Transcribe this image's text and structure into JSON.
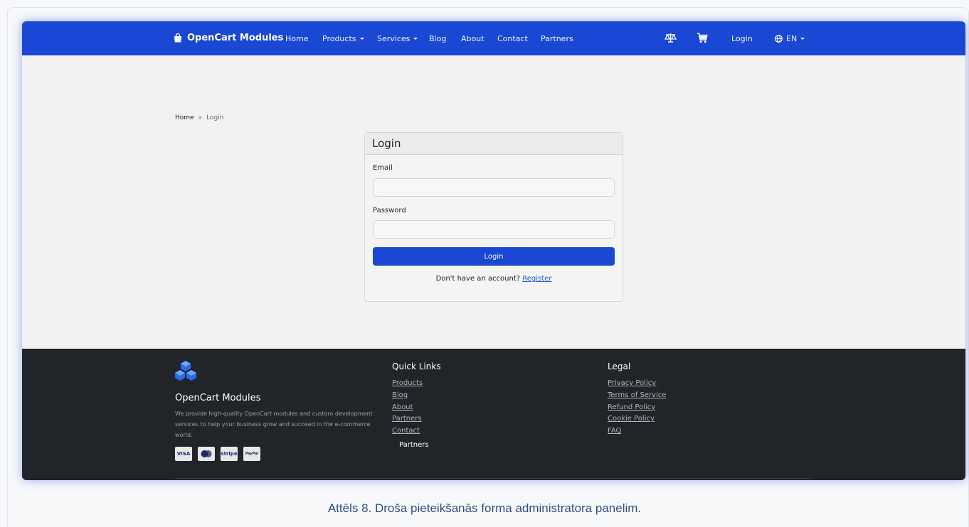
{
  "navbar": {
    "brand": "OpenCart Modules",
    "items": [
      {
        "label": "Home"
      },
      {
        "label": "Products"
      },
      {
        "label": "Services"
      },
      {
        "label": "Blog"
      },
      {
        "label": "About"
      },
      {
        "label": "Contact"
      },
      {
        "label": "Partners"
      }
    ],
    "icons": [
      "compare-icon",
      "cart-icon"
    ],
    "login": "Login",
    "language": "EN",
    "color": "#1a47d4"
  },
  "breadcrumb": {
    "home": "Home",
    "separator": "»",
    "current": "Login"
  },
  "login_form": {
    "title": "Login",
    "email_label": "Email",
    "email_value": "",
    "password_label": "Password",
    "password_value": "",
    "submit_label": "Login",
    "no_account_text": "Don't have an account?",
    "register_link": "Register"
  },
  "footer": {
    "brand": "OpenCart Modules",
    "description": "We provide high-quality OpenCart modules and custom development services to help your business grow and succeed in the e-commerce world.",
    "payment_methods": [
      "VISA",
      "mastercard",
      "stripe",
      "PayPal"
    ],
    "quick_links": {
      "title": "Quick Links",
      "links": [
        "Products",
        "Blog",
        "About",
        "Partners",
        "Contact"
      ]
    },
    "partners_label": "Partners",
    "legal": {
      "title": "Legal",
      "links": [
        "Privacy Policy",
        "Terms of Service",
        "Refund Policy",
        "Cookie Policy",
        "FAQ"
      ]
    },
    "background_color": "#212529"
  },
  "caption": "Attēls 8. Droša pieteikšanās forma administratora panelim."
}
